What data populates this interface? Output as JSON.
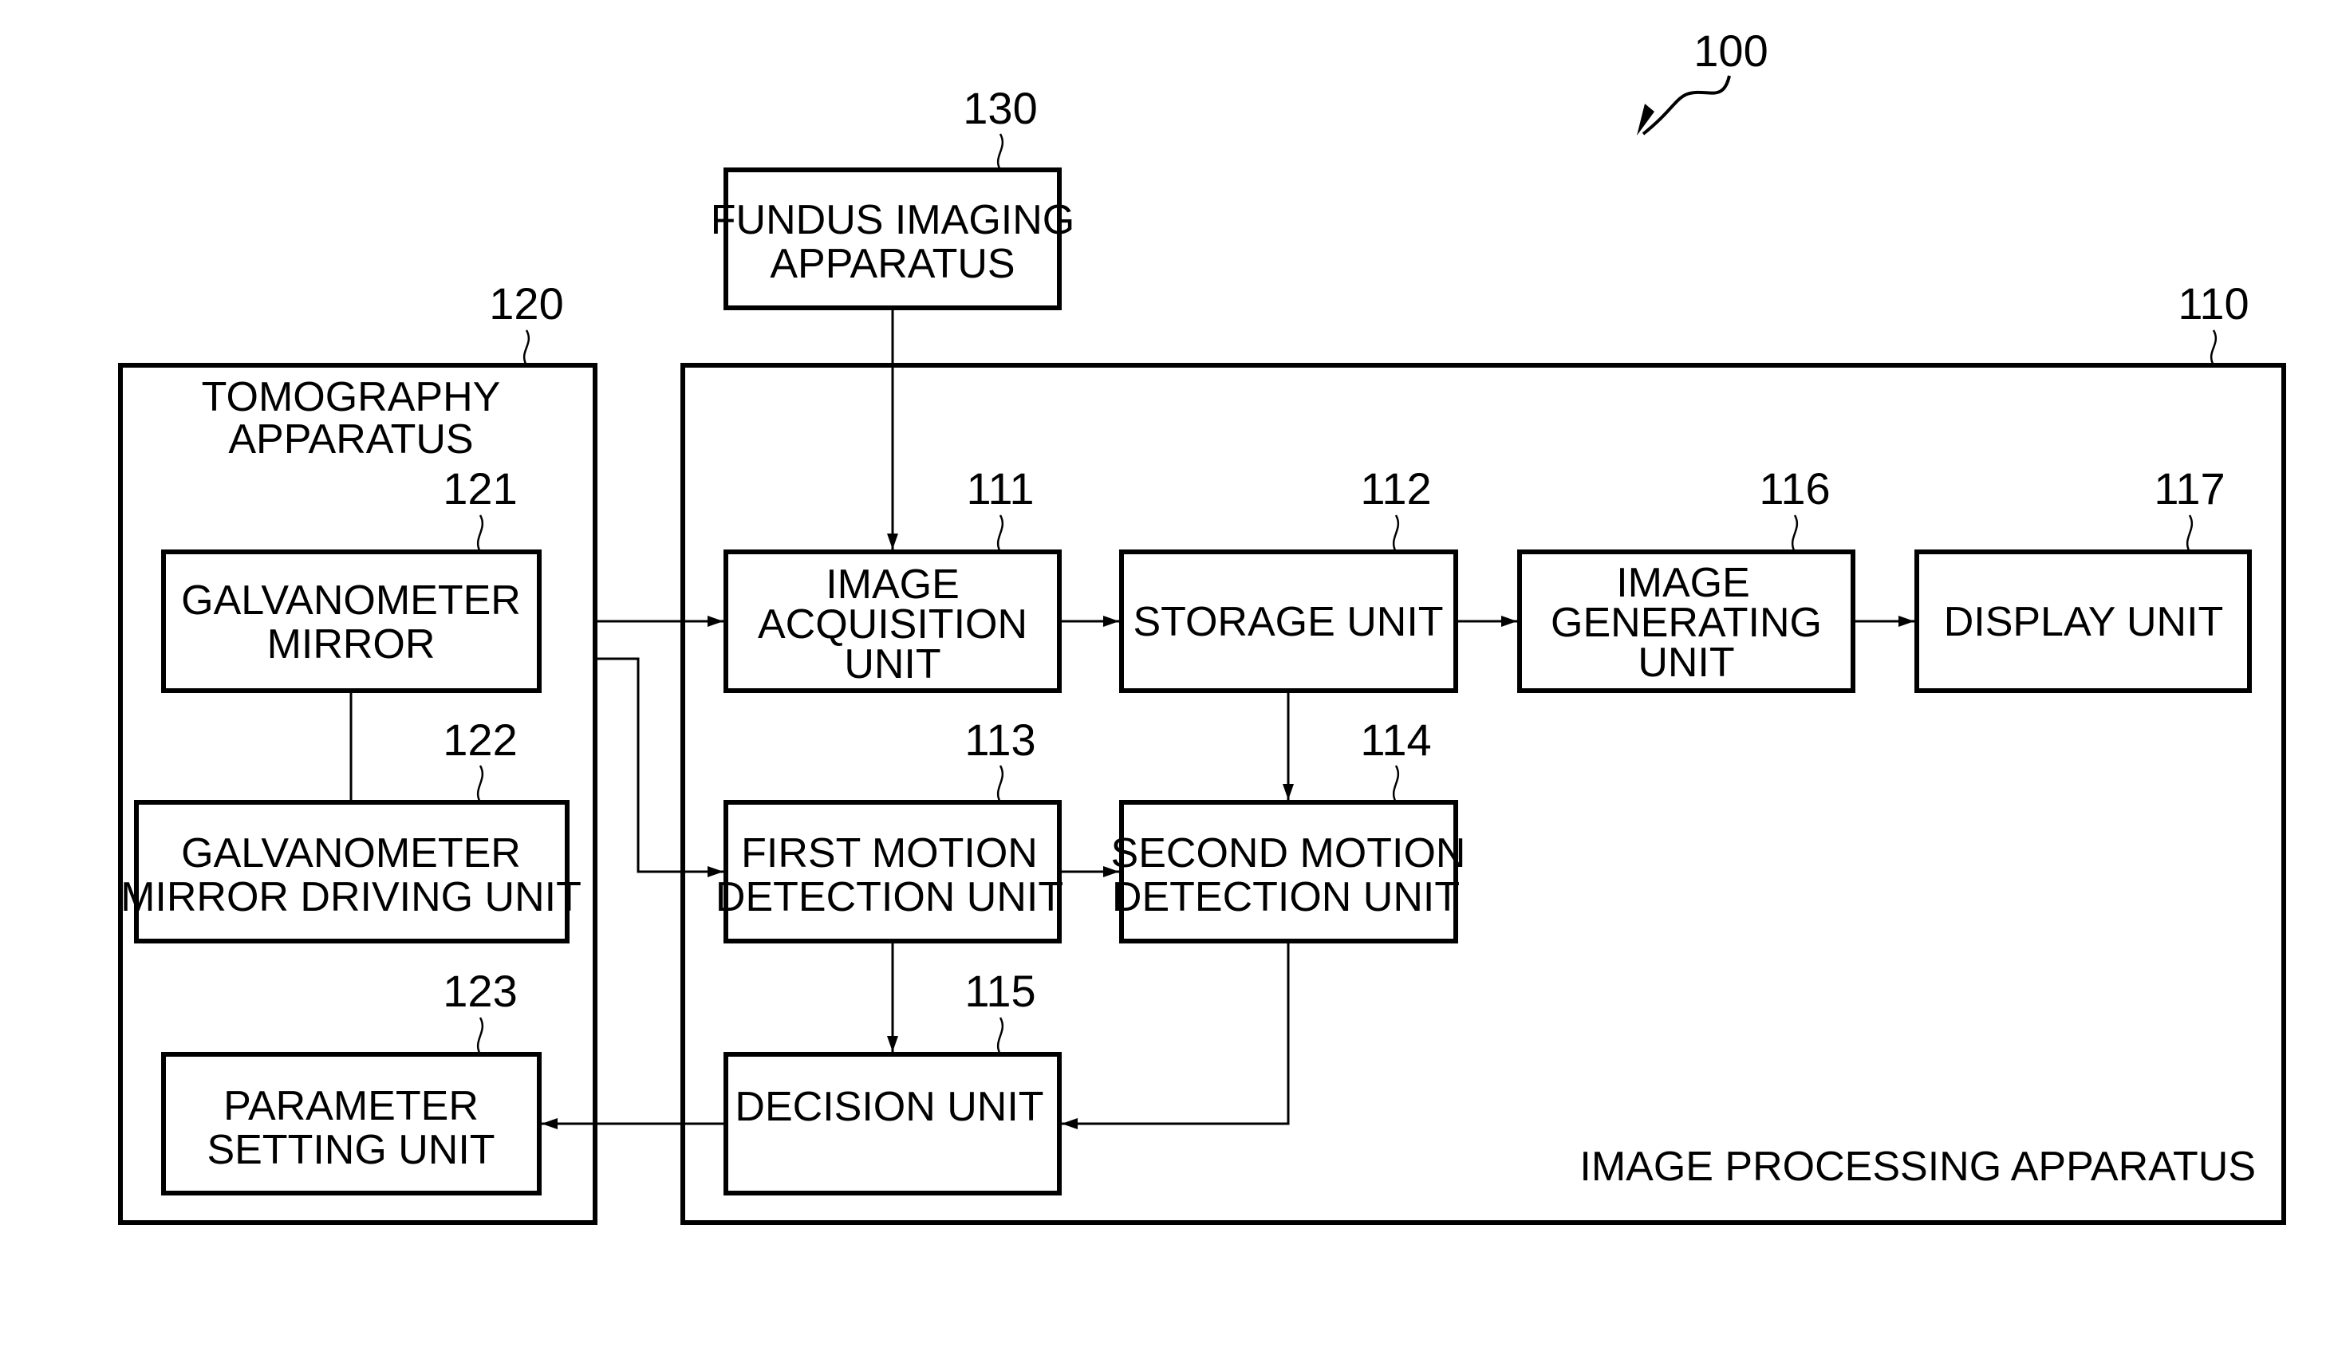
{
  "figure": {
    "ref": "100",
    "blocks": {
      "fundus": {
        "ref": "130",
        "lines": [
          "FUNDUS IMAGING",
          "APPARATUS"
        ]
      },
      "tomography": {
        "ref": "120",
        "lines": [
          "TOMOGRAPHY",
          "APPARATUS"
        ]
      },
      "image_processing": {
        "ref": "110",
        "caption": "IMAGE PROCESSING APPARATUS"
      },
      "galv_mirror": {
        "ref": "121",
        "lines": [
          "GALVANOMETER",
          "MIRROR"
        ]
      },
      "galv_driving": {
        "ref": "122",
        "lines": [
          "GALVANOMETER",
          "MIRROR DRIVING UNIT"
        ]
      },
      "param_setting": {
        "ref": "123",
        "lines": [
          "PARAMETER",
          "SETTING UNIT"
        ]
      },
      "image_acq": {
        "ref": "111",
        "lines": [
          "IMAGE",
          "ACQUISITION",
          "UNIT"
        ]
      },
      "storage": {
        "ref": "112",
        "lines": [
          "STORAGE UNIT"
        ]
      },
      "image_gen": {
        "ref": "116",
        "lines": [
          "IMAGE",
          "GENERATING",
          "UNIT"
        ]
      },
      "display": {
        "ref": "117",
        "lines": [
          "DISPLAY UNIT"
        ]
      },
      "first_motion": {
        "ref": "113",
        "lines": [
          "FIRST MOTION",
          "DETECTION UNIT"
        ]
      },
      "second_motion": {
        "ref": "114",
        "lines": [
          "SECOND MOTION",
          "DETECTION UNIT"
        ]
      },
      "decision": {
        "ref": "115",
        "lines": [
          "DECISION UNIT"
        ]
      }
    },
    "connections": [
      {
        "from": "fundus",
        "to": "image_acq"
      },
      {
        "from": "tomography",
        "to": "image_acq"
      },
      {
        "from": "tomography",
        "to": "first_motion"
      },
      {
        "from": "image_acq",
        "to": "storage"
      },
      {
        "from": "storage",
        "to": "image_gen"
      },
      {
        "from": "image_gen",
        "to": "display"
      },
      {
        "from": "storage",
        "to": "second_motion"
      },
      {
        "from": "first_motion",
        "to": "second_motion"
      },
      {
        "from": "first_motion",
        "to": "decision"
      },
      {
        "from": "second_motion",
        "to": "decision"
      },
      {
        "from": "decision",
        "to": "param_setting"
      },
      {
        "from": "galv_mirror",
        "to": "galv_driving",
        "arrow": false
      }
    ]
  }
}
